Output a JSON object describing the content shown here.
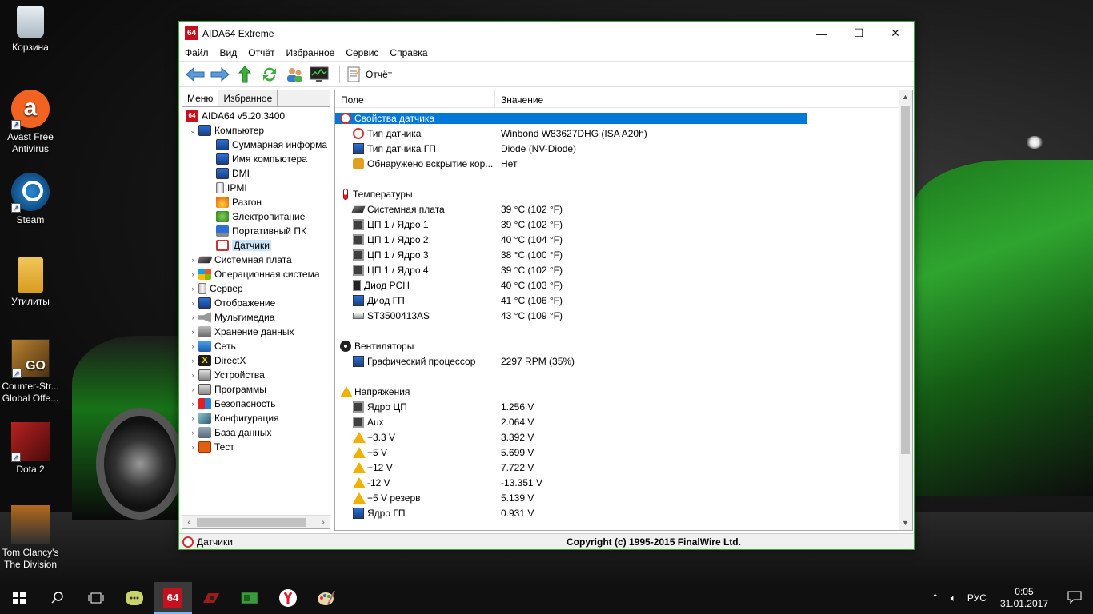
{
  "desktop": {
    "icons": [
      {
        "label": "Корзина",
        "icon": "recycle-bin-icon"
      },
      {
        "label": "Avast Free Antivirus",
        "icon": "avast-icon"
      },
      {
        "label": "Steam",
        "icon": "steam-icon"
      },
      {
        "label": "Утилиты",
        "icon": "folder-icon"
      },
      {
        "label": "Counter-Str... Global Offe...",
        "icon": "csgo-icon"
      },
      {
        "label": "Dota 2",
        "icon": "dota-icon"
      },
      {
        "label": "Tom Clancy's The Division",
        "icon": "division-icon"
      }
    ]
  },
  "window": {
    "logo": "64",
    "title": "AIDA64 Extreme",
    "controls": {
      "minimize": "—",
      "maximize": "☐",
      "close": "✕"
    },
    "menu": [
      "Файл",
      "Вид",
      "Отчёт",
      "Избранное",
      "Сервис",
      "Справка"
    ],
    "toolbar": {
      "report_label": "Отчёт"
    },
    "left_panel": {
      "tabs": [
        "Меню",
        "Избранное"
      ],
      "root": "AIDA64 v5.20.3400",
      "computer": "Компьютер",
      "computer_children": [
        "Суммарная информа",
        "Имя компьютера",
        "DMI",
        "IPMI",
        "Разгон",
        "Электропитание",
        "Портативный ПК",
        "Датчики"
      ],
      "categories": [
        "Системная плата",
        "Операционная система",
        "Сервер",
        "Отображение",
        "Мультимедиа",
        "Хранение данных",
        "Сеть",
        "DirectX",
        "Устройства",
        "Программы",
        "Безопасность",
        "Конфигурация",
        "База данных",
        "Тест"
      ]
    },
    "right_panel": {
      "col_field": "Поле",
      "col_value": "Значение",
      "sections": {
        "sensor_props": "Свойства датчика",
        "temps": "Температуры",
        "fans": "Вентиляторы",
        "voltages": "Напряжения"
      },
      "sensor_rows": [
        {
          "field": "Тип датчика",
          "value": "Winbond W83627DHG  (ISA A20h)"
        },
        {
          "field": "Тип датчика ГП",
          "value": "Diode  (NV-Diode)"
        },
        {
          "field": "Обнаружено вскрытие кор...",
          "value": "Нет"
        }
      ],
      "temp_rows": [
        {
          "field": "Системная плата",
          "value": "39 °C  (102 °F)"
        },
        {
          "field": "ЦП 1 / Ядро 1",
          "value": "39 °C  (102 °F)"
        },
        {
          "field": "ЦП 1 / Ядро 2",
          "value": "40 °C  (104 °F)"
        },
        {
          "field": "ЦП 1 / Ядро 3",
          "value": "38 °C  (100 °F)"
        },
        {
          "field": "ЦП 1 / Ядро 4",
          "value": "39 °C  (102 °F)"
        },
        {
          "field": "Диод PCH",
          "value": "40 °C  (103 °F)"
        },
        {
          "field": "Диод ГП",
          "value": "41 °C  (106 °F)"
        },
        {
          "field": "ST3500413AS",
          "value": "43 °C  (109 °F)"
        }
      ],
      "fan_rows": [
        {
          "field": "Графический процессор",
          "value": "2297 RPM  (35%)"
        }
      ],
      "voltage_rows": [
        {
          "field": "Ядро ЦП",
          "value": "1.256 V"
        },
        {
          "field": "Aux",
          "value": "2.064 V"
        },
        {
          "field": "+3.3 V",
          "value": "3.392 V"
        },
        {
          "field": "+5 V",
          "value": "5.699 V"
        },
        {
          "field": "+12 V",
          "value": "7.722 V"
        },
        {
          "field": "-12 V",
          "value": "-13.351 V"
        },
        {
          "field": "+5 V резерв",
          "value": "5.139 V"
        },
        {
          "field": "Ядро ГП",
          "value": "0.931 V"
        }
      ]
    },
    "status": {
      "left": "Датчики",
      "right": "Copyright (c) 1995-2015 FinalWire Ltd."
    }
  },
  "taskbar": {
    "pinned": [
      "start-icon",
      "search-icon",
      "task-view-icon",
      "chat-app-icon",
      "aida64-taskbar-icon",
      "msi-afterburner-icon",
      "gpu-tool-icon",
      "yandex-browser-icon",
      "paint-icon"
    ],
    "aida_label": "64",
    "tray": {
      "language": "РУС",
      "time": "0:05",
      "date": "31.01.2017"
    }
  }
}
